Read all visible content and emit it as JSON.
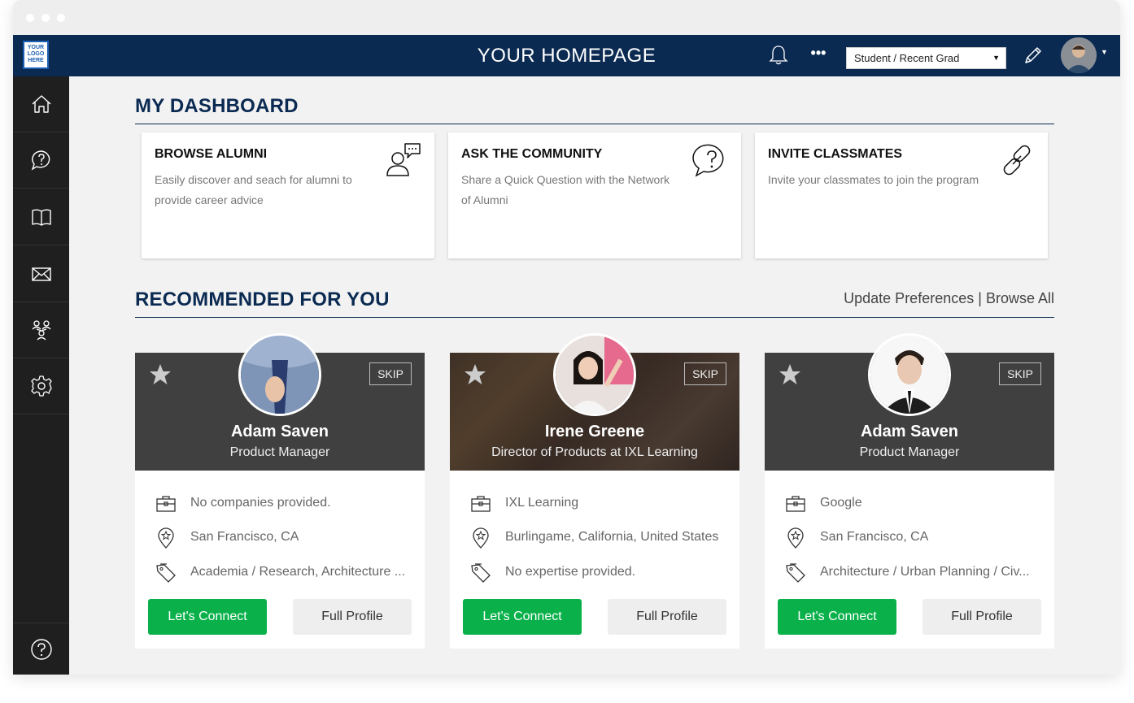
{
  "header": {
    "logo_text": "YOUR LOGO HERE",
    "title": "YOUR HOMEPAGE",
    "more_label": "•••",
    "role_select": {
      "selected": "Student / Recent Grad"
    }
  },
  "sidebar": {
    "items": [
      {
        "icon": "home-icon"
      },
      {
        "icon": "question-bubble-icon"
      },
      {
        "icon": "book-icon"
      },
      {
        "icon": "mail-icon"
      },
      {
        "icon": "people-network-icon"
      },
      {
        "icon": "gear-icon"
      }
    ],
    "help_icon": "help-icon"
  },
  "dashboard": {
    "title": "MY DASHBOARD",
    "cards": [
      {
        "title": "BROWSE ALUMNI",
        "text": "Easily discover and seach for alumni to provide career advice",
        "icon": "person-chat-icon"
      },
      {
        "title": "ASK THE COMMUNITY",
        "text": "Share a Quick Question with the Network of Alumni",
        "icon": "question-bubble-icon"
      },
      {
        "title": "INVITE CLASSMATES",
        "text": "Invite your classmates to join the program",
        "icon": "link-icon"
      }
    ]
  },
  "recommended": {
    "title": "RECOMMENDED FOR YOU",
    "update_link": "Update Preferences",
    "separator": "|",
    "browse_link": "Browse All",
    "skip_label": "SKIP",
    "connect_label": "Let's Connect",
    "profile_label": "Full Profile",
    "people": [
      {
        "name": "Adam Saven",
        "role": "Product Manager",
        "company": "No companies provided.",
        "location": "San Francisco, CA",
        "expertise": "Academia / Research, Architecture ..."
      },
      {
        "name": "Irene Greene",
        "role": "Director of Products at IXL Learning",
        "company": "IXL Learning",
        "location": "Burlingame, California, United States",
        "expertise": "No expertise provided."
      },
      {
        "name": "Adam Saven",
        "role": "Product Manager",
        "company": "Google",
        "location": "San Francisco, CA",
        "expertise": "Architecture / Urban Planning / Civ..."
      }
    ]
  },
  "colors": {
    "navy": "#0b2a52",
    "sidebar": "#1f1f1f",
    "connect_green": "#0ab14b",
    "card_header": "#404040"
  }
}
